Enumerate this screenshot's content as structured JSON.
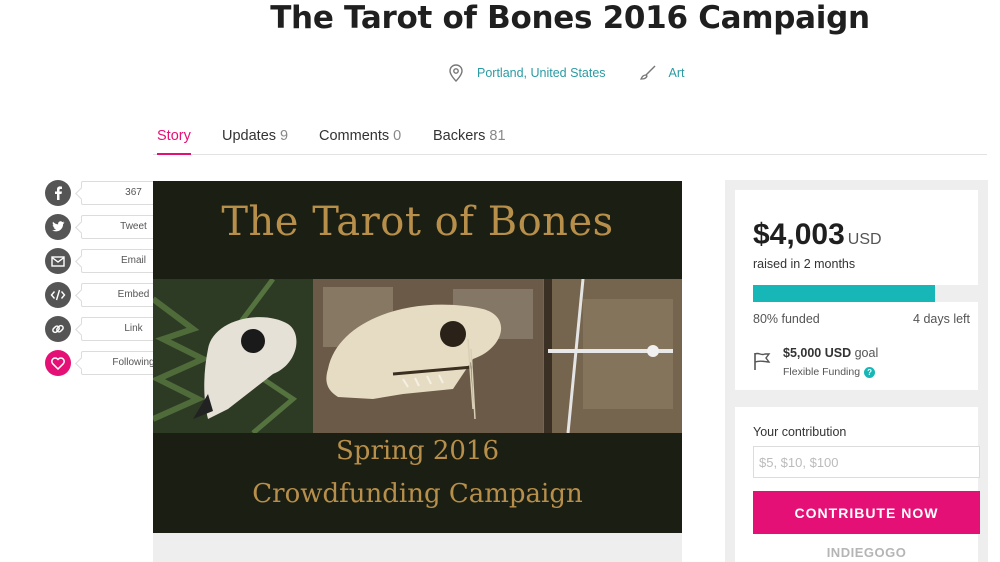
{
  "campaign": {
    "title": "The Tarot of Bones 2016 Campaign",
    "location": "Portland, United States",
    "category": "Art"
  },
  "tabs": [
    {
      "label": "Story",
      "count": ""
    },
    {
      "label": "Updates",
      "count": "9"
    },
    {
      "label": "Comments",
      "count": "0"
    },
    {
      "label": "Backers",
      "count": "81"
    }
  ],
  "share": {
    "facebook": "367",
    "twitter": "Tweet",
    "email": "Email",
    "embed": "Embed",
    "link": "Link",
    "follow": "Following"
  },
  "hero": {
    "title": "The Tarot of Bones",
    "subtitle_1": "Spring 2016",
    "subtitle_2": "Crowdfunding Campaign"
  },
  "funding": {
    "amount": "$4,003",
    "currency": "USD",
    "raised": "raised in 2 months",
    "progress": 0.8,
    "funded": "80% funded",
    "days_left": "4 days left",
    "goal_amount": "$5,000 USD",
    "goal_word": "goal",
    "funding_type": "Flexible Funding",
    "help": "?"
  },
  "contribute": {
    "label": "Your contribution",
    "placeholder": "$5, $10, $100",
    "button": "CONTRIBUTE NOW",
    "brand": "INDIEGOGO"
  },
  "colors": {
    "accent": "#e51075",
    "teal": "#18b7b7",
    "link": "#2a9ba3",
    "hero_bg": "#1b1f13",
    "hero_text": "#b88f4a"
  },
  "icons": [
    "location-pin-icon",
    "brush-icon",
    "facebook-icon",
    "twitter-icon",
    "email-icon",
    "embed-icon",
    "link-icon",
    "heart-icon",
    "flag-icon",
    "help-icon"
  ]
}
